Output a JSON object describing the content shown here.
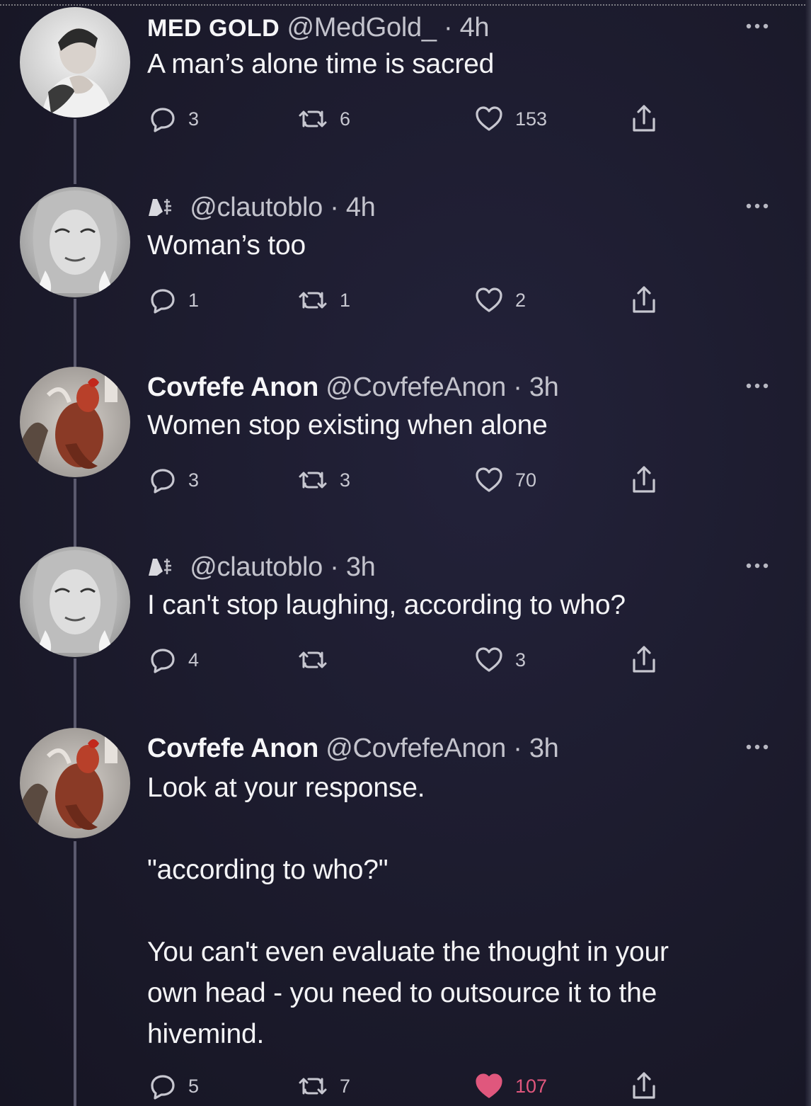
{
  "thread": {
    "tweets": [
      {
        "name": "MED GOLD",
        "handle": "@MedGold_",
        "time": "4h",
        "text": "A man’s alone time is sacred",
        "replies": "3",
        "retweets": "6",
        "likes": "153",
        "liked": false
      },
      {
        "name": "",
        "handle": "@clautoblo",
        "time": "4h",
        "text": "Woman’s too",
        "replies": "1",
        "retweets": "1",
        "likes": "2",
        "liked": false
      },
      {
        "name": "Covfefe Anon",
        "handle": "@CovfefeAnon",
        "time": "3h",
        "text": "Women stop existing when alone",
        "replies": "3",
        "retweets": "3",
        "likes": "70",
        "liked": false
      },
      {
        "name": "",
        "handle": "@clautoblo",
        "time": "3h",
        "text": "I can't stop laughing, according to who?",
        "replies": "4",
        "retweets": "",
        "likes": "3",
        "liked": false
      },
      {
        "name": "Covfefe Anon",
        "handle": "@CovfefeAnon",
        "time": "3h",
        "text_lines": [
          "Look at your response.",
          "",
          "\"according to who?\"",
          "",
          "You can't even evaluate the thought in your",
          "own head - you need to outsource it to the",
          "hivemind."
        ],
        "replies": "5",
        "retweets": "7",
        "likes": "107",
        "liked": true
      }
    ]
  },
  "colors": {
    "background": "#1c1b2c",
    "text": "#f4f4f6",
    "muted": "#c3c3cc",
    "thread_line": "#5b5a6e",
    "like_active": "#e0577d"
  }
}
